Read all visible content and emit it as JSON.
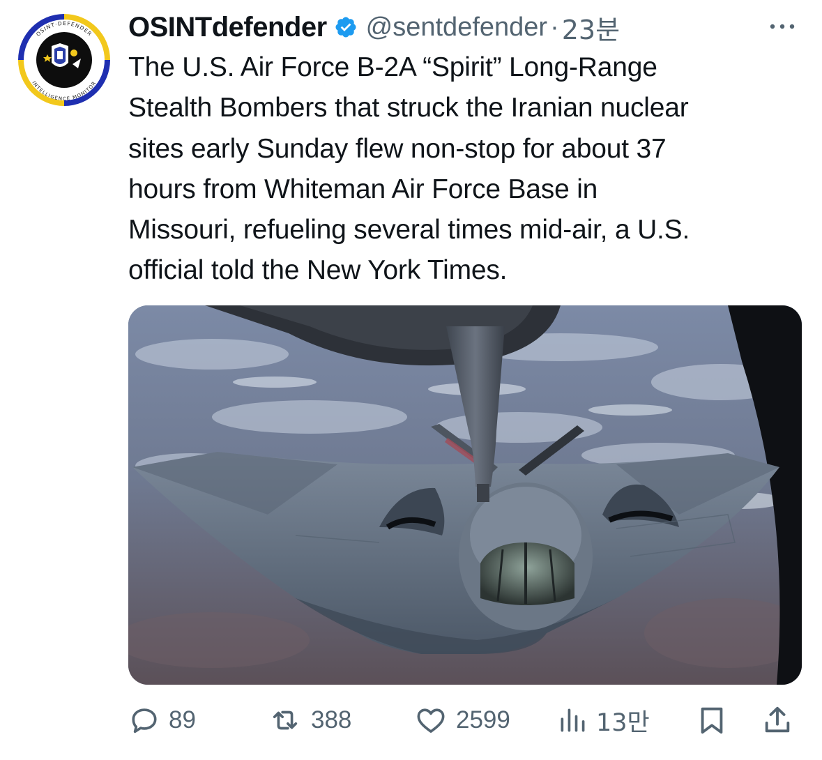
{
  "tweet": {
    "display_name": "OSINTdefender",
    "handle": "@sentdefender",
    "separator": "·",
    "time": "23분",
    "text": "The U.S. Air Force B-2A “Spirit” Long-Range\nStealth Bombers that struck the Iranian nuclear\nsites early Sunday flew non-stop for about 37\nhours from Whiteman Air Force Base in\nMissouri, refueling several times mid-air, a U.S.\nofficial told the New York Times."
  },
  "avatar": {
    "ring_top_text": "OSINT·DEFENDER",
    "ring_bottom_text": "INTELLIGENCE MONITOR"
  },
  "metrics": {
    "replies": "89",
    "reposts": "388",
    "likes": "2599",
    "views": "13만"
  },
  "colors": {
    "text_primary": "#0f1419",
    "text_secondary": "#536471",
    "verified_blue": "#1d9bf0",
    "avatar_ring_blue": "#1f2fb0",
    "avatar_ring_yellow": "#f2c81c"
  },
  "icons": {
    "verified": "verified-badge-icon",
    "more": "more-icon",
    "reply": "reply-icon",
    "repost": "repost-icon",
    "like": "like-icon",
    "views": "views-icon",
    "bookmark": "bookmark-icon",
    "share": "share-icon"
  }
}
